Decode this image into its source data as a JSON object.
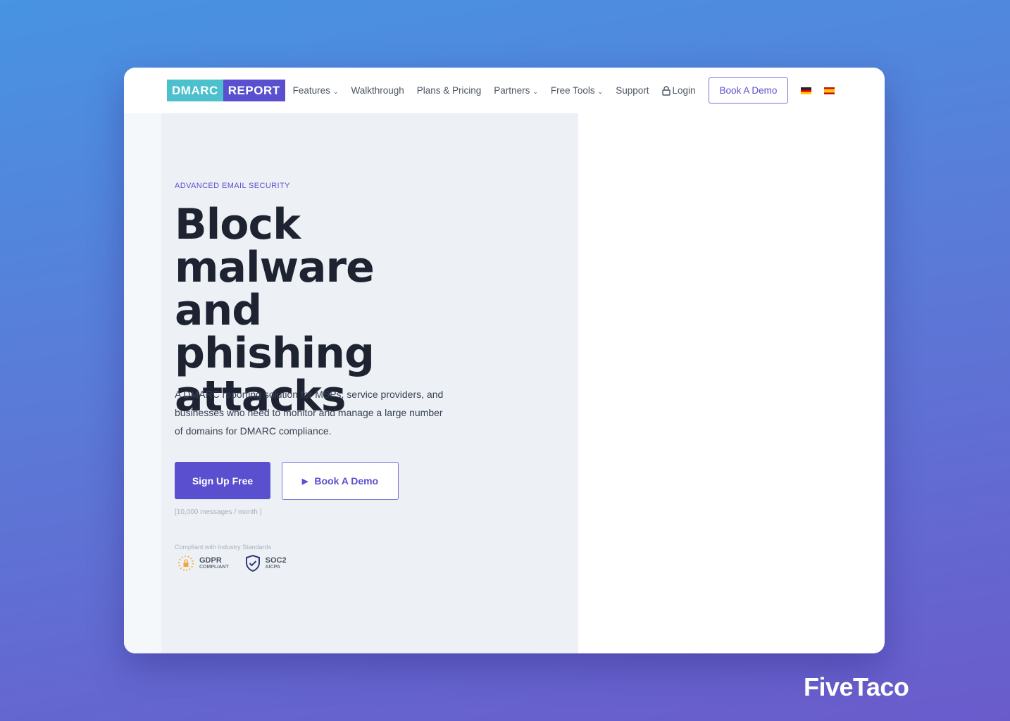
{
  "nav": {
    "logo_left": "DMARC",
    "logo_right": "REPORT",
    "items": [
      {
        "label": "Features",
        "dropdown": true
      },
      {
        "label": "Walkthrough"
      },
      {
        "label": "Plans & Pricing"
      },
      {
        "label": "Partners",
        "dropdown": true
      },
      {
        "label": "Free Tools",
        "dropdown": true
      },
      {
        "label": "Support"
      }
    ],
    "login": "Login",
    "book_demo": "Book A Demo",
    "languages": [
      "German",
      "Spanish"
    ]
  },
  "hero": {
    "eyebrow": "ADVANCED EMAIL SECURITY",
    "title": "Block malware and phishing attacks",
    "description": "A DMARC reporting solution for MSPs, service providers, and businesses who need to monitor and manage a large number of domains for DMARC compliance.",
    "signup": "Sign Up Free",
    "book_demo": "Book A Demo",
    "note": "[10,000 messages / month ]",
    "compliance_label": "Compliant with Industry Standards",
    "badges": [
      {
        "title": "GDPR",
        "subtitle": "COMPLIANT"
      },
      {
        "title": "SOC2",
        "subtitle": "AICPA"
      }
    ]
  },
  "watermark": "FiveTaco",
  "colors": {
    "accent": "#5a4fcf",
    "teal": "#4cc0cc"
  }
}
